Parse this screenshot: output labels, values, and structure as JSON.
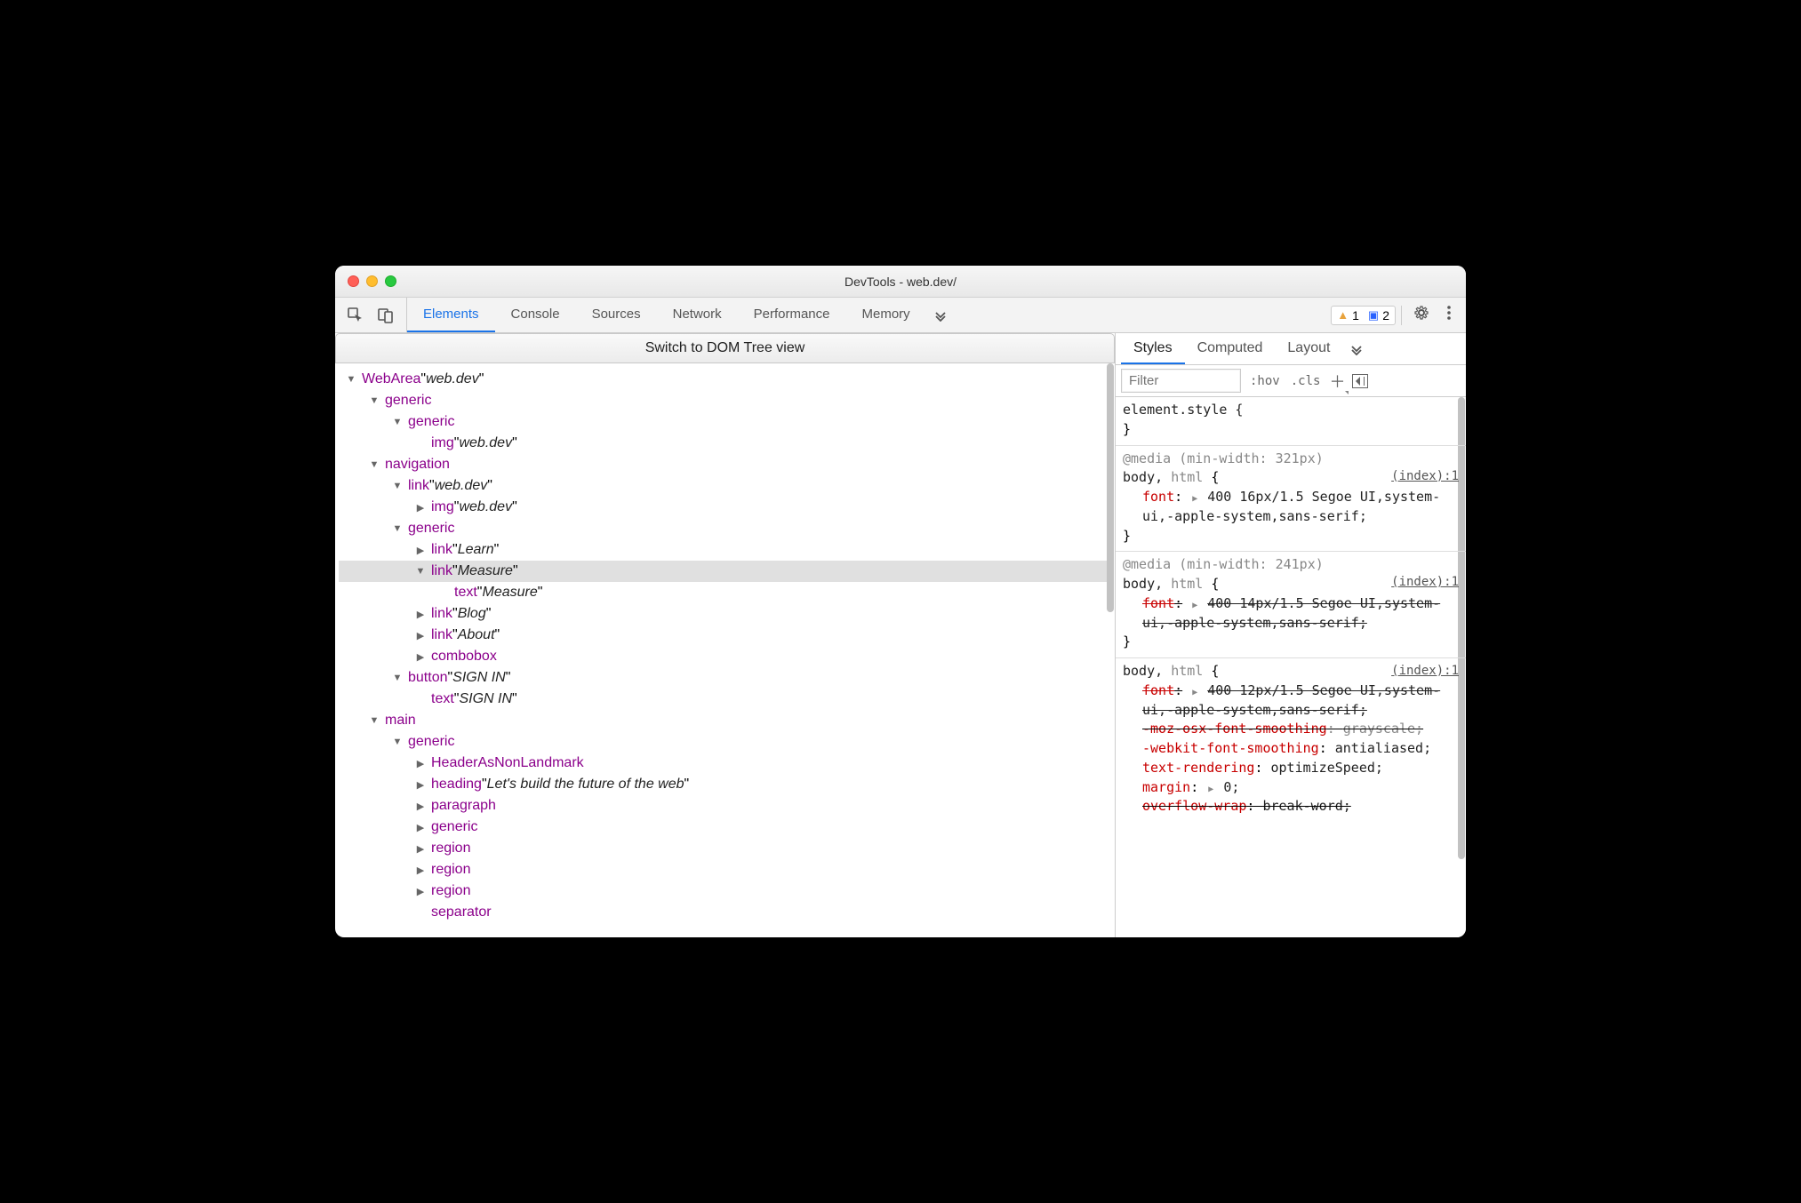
{
  "window": {
    "title": "DevTools - web.dev/"
  },
  "toolbar": {
    "tabs": [
      "Elements",
      "Console",
      "Sources",
      "Network",
      "Performance",
      "Memory"
    ],
    "activeTab": 0,
    "warnings": "1",
    "messages": "2"
  },
  "leftPane": {
    "switchLabel": "Switch to DOM Tree view",
    "tree": [
      {
        "depth": 0,
        "arrow": "down",
        "role": "WebArea",
        "label": "web.dev",
        "sel": false
      },
      {
        "depth": 1,
        "arrow": "down",
        "role": "generic",
        "label": "",
        "sel": false
      },
      {
        "depth": 2,
        "arrow": "down",
        "role": "generic",
        "label": "",
        "sel": false
      },
      {
        "depth": 3,
        "arrow": "none",
        "role": "img",
        "label": "web.dev",
        "sel": false
      },
      {
        "depth": 1,
        "arrow": "down",
        "role": "navigation",
        "label": "",
        "sel": false
      },
      {
        "depth": 2,
        "arrow": "down",
        "role": "link",
        "label": "web.dev",
        "sel": false
      },
      {
        "depth": 3,
        "arrow": "right",
        "role": "img",
        "label": "web.dev",
        "sel": false
      },
      {
        "depth": 2,
        "arrow": "down",
        "role": "generic",
        "label": "",
        "sel": false
      },
      {
        "depth": 3,
        "arrow": "right",
        "role": "link",
        "label": "Learn",
        "sel": false
      },
      {
        "depth": 3,
        "arrow": "down",
        "role": "link",
        "label": "Measure",
        "sel": true
      },
      {
        "depth": 4,
        "arrow": "none",
        "role": "text",
        "label": "Measure",
        "sel": false
      },
      {
        "depth": 3,
        "arrow": "right",
        "role": "link",
        "label": "Blog",
        "sel": false
      },
      {
        "depth": 3,
        "arrow": "right",
        "role": "link",
        "label": "About",
        "sel": false
      },
      {
        "depth": 3,
        "arrow": "right",
        "role": "combobox",
        "label": "",
        "sel": false
      },
      {
        "depth": 2,
        "arrow": "down",
        "role": "button",
        "label": "SIGN IN",
        "sel": false
      },
      {
        "depth": 3,
        "arrow": "none",
        "role": "text",
        "label": "SIGN IN",
        "sel": false
      },
      {
        "depth": 1,
        "arrow": "down",
        "role": "main",
        "label": "",
        "sel": false
      },
      {
        "depth": 2,
        "arrow": "down",
        "role": "generic",
        "label": "",
        "sel": false
      },
      {
        "depth": 3,
        "arrow": "right",
        "role": "HeaderAsNonLandmark",
        "label": "",
        "sel": false
      },
      {
        "depth": 3,
        "arrow": "right",
        "role": "heading",
        "label": "Let's build the future of the web",
        "sel": false
      },
      {
        "depth": 3,
        "arrow": "right",
        "role": "paragraph",
        "label": "",
        "sel": false
      },
      {
        "depth": 3,
        "arrow": "right",
        "role": "generic",
        "label": "",
        "sel": false
      },
      {
        "depth": 3,
        "arrow": "right",
        "role": "region",
        "label": "",
        "sel": false
      },
      {
        "depth": 3,
        "arrow": "right",
        "role": "region",
        "label": "",
        "sel": false
      },
      {
        "depth": 3,
        "arrow": "right",
        "role": "region",
        "label": "",
        "sel": false
      },
      {
        "depth": 3,
        "arrow": "none",
        "role": "separator",
        "label": "",
        "sel": false
      }
    ]
  },
  "rightPane": {
    "tabs": [
      "Styles",
      "Computed",
      "Layout"
    ],
    "activeTab": 0,
    "filterPlaceholder": "Filter",
    "hov": ":hov",
    "cls": ".cls",
    "elementStyle": "element.style {",
    "closeBrace": "}",
    "r1": {
      "media": "@media (min-width: 321px)",
      "selectorPrimary": "body,",
      "selectorDim": "html",
      "openBrace": "{",
      "source": "(index):1",
      "prop": "font",
      "sep": ":",
      "val": "400 16px/1.5 Segoe UI,system-ui,-apple-system,sans-serif;"
    },
    "r2": {
      "media": "@media (min-width: 241px)",
      "selectorPrimary": "body,",
      "selectorDim": "html",
      "openBrace": "{",
      "source": "(index):1",
      "prop": "font",
      "sep": ":",
      "val": "400 14px/1.5 Segoe UI,system-ui,-apple-system,sans-serif;"
    },
    "r3": {
      "selectorPrimary": "body,",
      "selectorDim": "html",
      "openBrace": "{",
      "source": "(index):1",
      "l1prop": "font",
      "l1sep": ":",
      "l1val": "400 12px/1.5 Segoe UI,system-ui,-apple-system,sans-serif;",
      "l2prop": "-moz-osx-font-smoothing",
      "l2sep": ": ",
      "l2val": "grayscale;",
      "l3prop": "-webkit-font-smoothing",
      "l3sep": ": ",
      "l3val": "antialiased;",
      "l4prop": "text-rendering",
      "l4sep": ": ",
      "l4val": "optimizeSpeed;",
      "l5prop": "margin",
      "l5sep": ":",
      "l5val": "0;",
      "l6prop": "overflow-wrap",
      "l6sep": ": ",
      "l6val": "break-word;"
    }
  }
}
